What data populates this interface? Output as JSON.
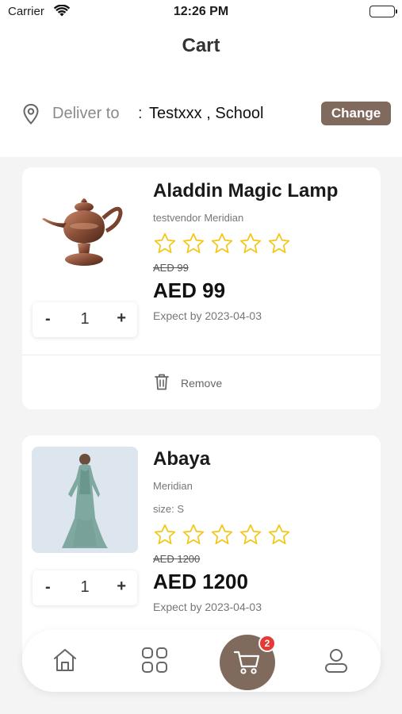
{
  "status_bar": {
    "carrier": "Carrier",
    "time": "12:26 PM"
  },
  "header": {
    "title": "Cart"
  },
  "delivery": {
    "label": "Deliver to",
    "separator": ":",
    "address": "Testxxx , School",
    "change_label": "Change"
  },
  "items": [
    {
      "name": "Aladdin Magic Lamp",
      "vendor": "testvendor Meridian",
      "rating": 0,
      "old_price": "AED 99",
      "price": "AED 99",
      "expect": "Expect by 2023-04-03",
      "quantity": "1",
      "minus": "-",
      "plus": "+",
      "remove_label": "Remove"
    },
    {
      "name": "Abaya",
      "vendor": "Meridian",
      "size": "size: S",
      "rating": 0,
      "old_price": "AED 1200",
      "price": "AED 1200",
      "expect": "Expect by 2023-04-03",
      "quantity": "1",
      "minus": "-",
      "plus": "+"
    }
  ],
  "nav": {
    "items": [
      "home-icon",
      "grid-icon",
      "cart-icon",
      "profile-icon"
    ],
    "cart_badge": "2"
  },
  "colors": {
    "accent": "#806a5e",
    "star": "#f5c518",
    "badge": "#e53935"
  }
}
